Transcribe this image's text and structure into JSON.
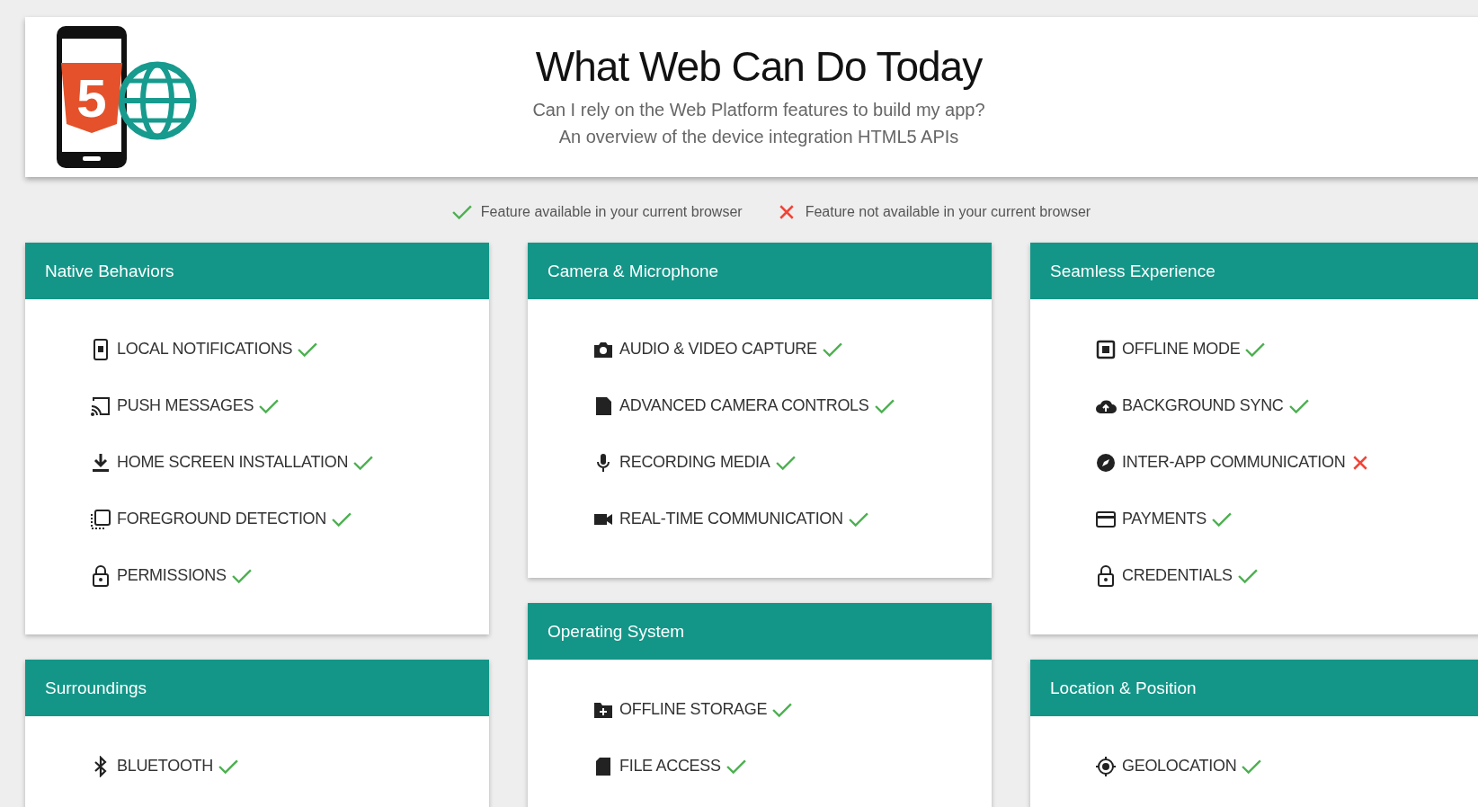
{
  "header": {
    "logo_mark": "5",
    "title": "What Web Can Do Today",
    "subtitle_lines": [
      "Can I rely on the Web Platform features to build my app?",
      "An overview of the device integration HTML5 APIs"
    ]
  },
  "legend": [
    {
      "available": true,
      "label": "Feature available in your current browser"
    },
    {
      "available": false,
      "label": "Feature not available in your current browser"
    }
  ],
  "columns": [
    {
      "sections": [
        {
          "title": "Native Behaviors",
          "features": [
            {
              "kind": "notification",
              "label": "LOCAL NOTIFICATIONS",
              "available": true
            },
            {
              "kind": "cast",
              "label": "PUSH MESSAGES",
              "available": true
            },
            {
              "kind": "download",
              "label": "HOME SCREEN INSTALLATION",
              "available": true
            },
            {
              "kind": "window",
              "label": "FOREGROUND DETECTION",
              "available": true
            },
            {
              "kind": "lock",
              "label": "PERMISSIONS",
              "available": true
            }
          ]
        },
        {
          "title": "Surroundings",
          "features": [
            {
              "kind": "bluetooth",
              "label": "BLUETOOTH",
              "available": true
            }
          ]
        }
      ]
    },
    {
      "sections": [
        {
          "title": "Camera & Microphone",
          "features": [
            {
              "kind": "camera",
              "label": "AUDIO & VIDEO CAPTURE",
              "available": true
            },
            {
              "kind": "film",
              "label": "ADVANCED CAMERA CONTROLS",
              "available": true
            },
            {
              "kind": "mic",
              "label": "RECORDING MEDIA",
              "available": true
            },
            {
              "kind": "video",
              "label": "REAL-TIME COMMUNICATION",
              "available": true
            }
          ]
        },
        {
          "title": "Operating System",
          "features": [
            {
              "kind": "folder",
              "label": "OFFLINE STORAGE",
              "available": true
            },
            {
              "kind": "file",
              "label": "FILE ACCESS",
              "available": true
            }
          ]
        }
      ]
    },
    {
      "sections": [
        {
          "title": "Seamless Experience",
          "features": [
            {
              "kind": "box",
              "label": "OFFLINE MODE",
              "available": true
            },
            {
              "kind": "cloud",
              "label": "BACKGROUND SYNC",
              "available": true
            },
            {
              "kind": "compass",
              "label": "INTER-APP COMMUNICATION",
              "available": false
            },
            {
              "kind": "card",
              "label": "PAYMENTS",
              "available": true
            },
            {
              "kind": "lock",
              "label": "CREDENTIALS",
              "available": true
            }
          ]
        },
        {
          "title": "Location & Position",
          "features": [
            {
              "kind": "target",
              "label": "GEOLOCATION",
              "available": true
            }
          ]
        }
      ]
    }
  ]
}
